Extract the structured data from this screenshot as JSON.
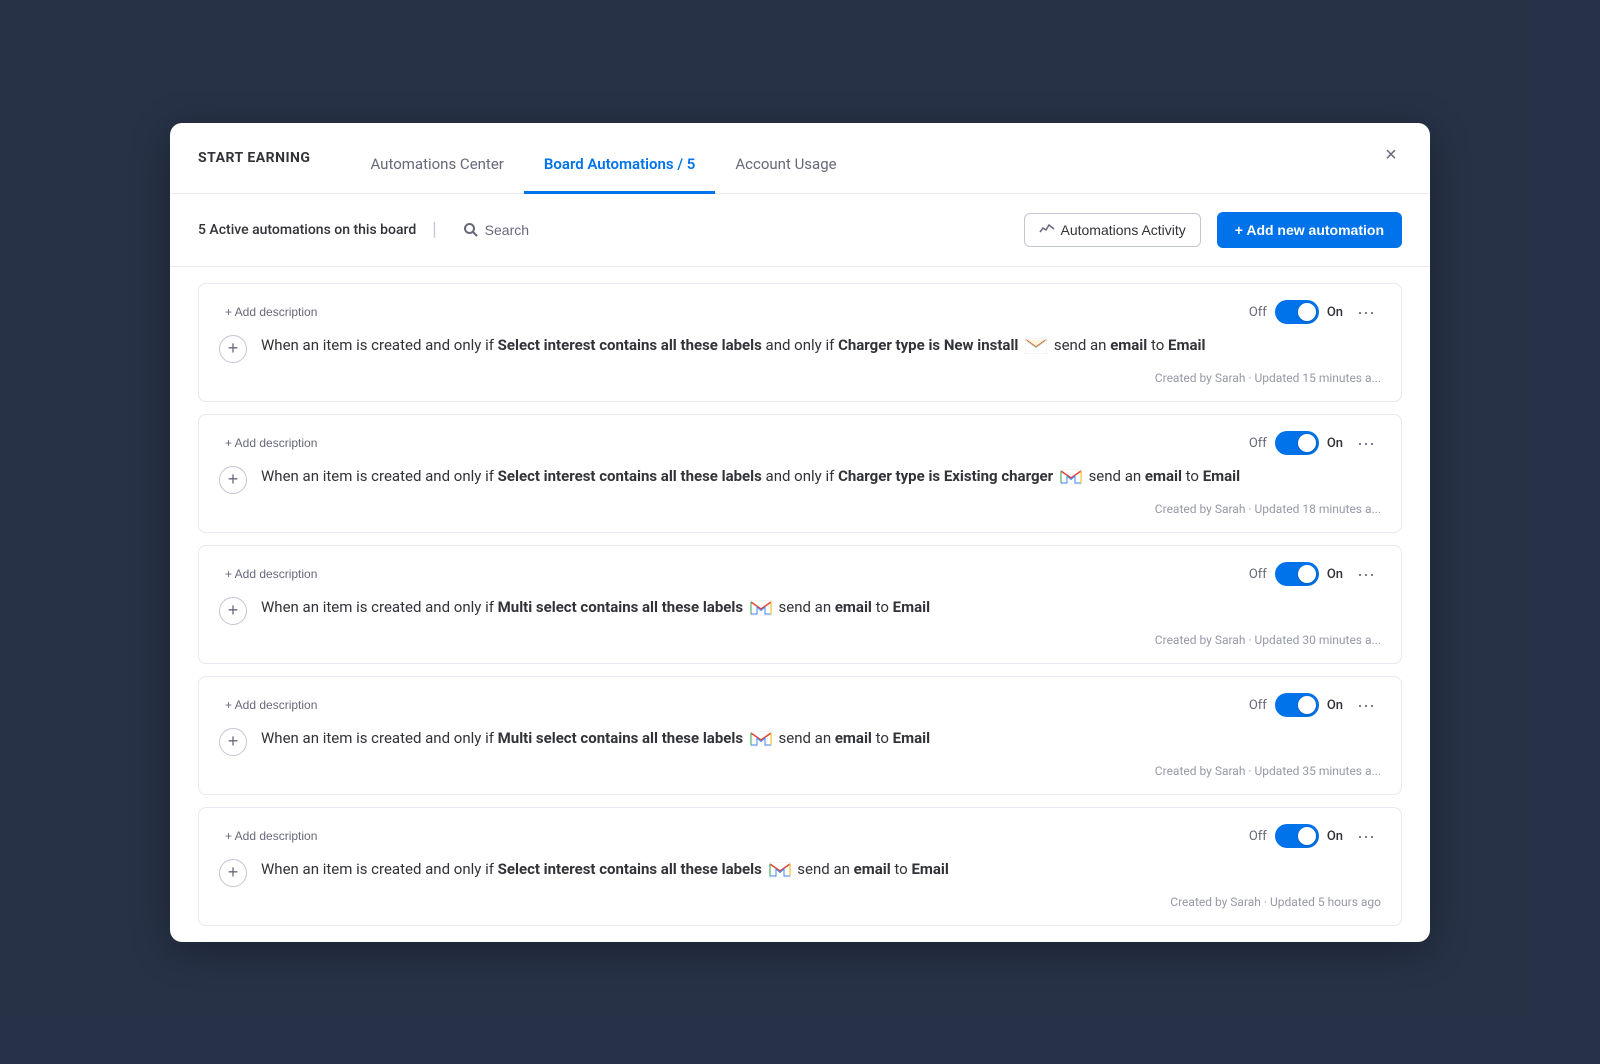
{
  "modal": {
    "title": "START EARNING",
    "close_label": "×"
  },
  "tabs": [
    {
      "id": "automations-center",
      "label": "Automations Center",
      "active": false
    },
    {
      "id": "board-automations",
      "label": "Board Automations / 5",
      "active": true
    },
    {
      "id": "account-usage",
      "label": "Account Usage",
      "active": false
    }
  ],
  "toolbar": {
    "active_count_text": "5 Active automations on this board",
    "search_label": "Search",
    "automations_activity_label": "Automations Activity",
    "add_automation_label": "+ Add new automation"
  },
  "automations": [
    {
      "id": 1,
      "add_description_label": "+ Add description",
      "toggle_off_label": "Off",
      "toggle_on_label": "On",
      "toggle_state": true,
      "text_pre": "When an item is created and only if ",
      "condition1": "Select interest contains all these labels",
      "text_mid1": " and only if ",
      "condition2": "Charger type is New install",
      "text_mid2": " send an ",
      "action": "email",
      "text_mid3": " to ",
      "target": "Email",
      "has_gmail": true,
      "gmail_position": "after_condition2",
      "footer": "Created by Sarah · Updated 15 minutes a..."
    },
    {
      "id": 2,
      "add_description_label": "+ Add description",
      "toggle_off_label": "Off",
      "toggle_on_label": "On",
      "toggle_state": true,
      "text_pre": "When an item is created and only if ",
      "condition1": "Select interest contains all these labels",
      "text_mid1": " and only if ",
      "condition2": "Charger type is Existing charger",
      "text_mid2": " send an ",
      "action": "email",
      "text_mid3": " to ",
      "target": "Email",
      "has_gmail": true,
      "gmail_position": "after_condition2",
      "footer": "Created by Sarah · Updated 18 minutes a..."
    },
    {
      "id": 3,
      "add_description_label": "+ Add description",
      "toggle_off_label": "Off",
      "toggle_on_label": "On",
      "toggle_state": true,
      "text_pre": "When an item is created and only if ",
      "condition1": "Multi select contains all these labels",
      "text_mid1": "",
      "condition2": "",
      "text_mid2": " send an ",
      "action": "email",
      "text_mid3": " to ",
      "target": "Email",
      "has_gmail": true,
      "gmail_position": "after_condition1",
      "footer": "Created by Sarah · Updated 30 minutes a..."
    },
    {
      "id": 4,
      "add_description_label": "+ Add description",
      "toggle_off_label": "Off",
      "toggle_on_label": "On",
      "toggle_state": true,
      "text_pre": "When an item is created and only if ",
      "condition1": "Multi select contains all these labels",
      "text_mid1": "",
      "condition2": "",
      "text_mid2": " send an ",
      "action": "email",
      "text_mid3": " to ",
      "target": "Email",
      "has_gmail": true,
      "gmail_position": "after_condition1",
      "footer": "Created by Sarah · Updated 35 minutes a..."
    },
    {
      "id": 5,
      "add_description_label": "+ Add description",
      "toggle_off_label": "Off",
      "toggle_on_label": "On",
      "toggle_state": true,
      "text_pre": "When an item is created and only if ",
      "condition1": "Select interest contains all these labels",
      "text_mid1": "",
      "condition2": "",
      "text_mid2": " send an ",
      "action": "email",
      "text_mid3": " to ",
      "target": "Email",
      "has_gmail": true,
      "gmail_position": "after_condition1",
      "footer": "Created by Sarah · Updated 5 hours ago"
    }
  ],
  "colors": {
    "accent_blue": "#0073ea",
    "text_primary": "#323338",
    "text_secondary": "#676879",
    "border": "#e6e9ef"
  }
}
